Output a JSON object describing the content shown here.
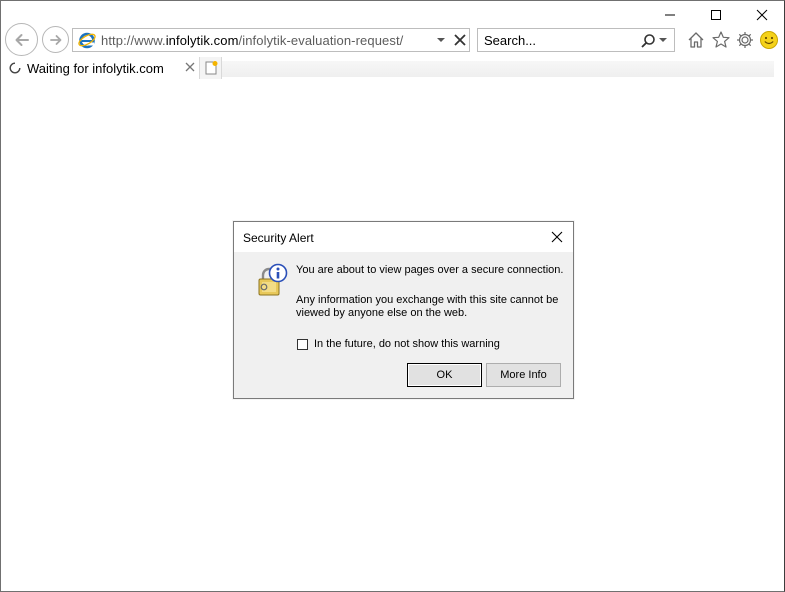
{
  "browser": {
    "address": {
      "prefix": "http://www.",
      "domain": "infolytik.com",
      "path": "/infolytik-evaluation-request/"
    },
    "search": {
      "placeholder": "Search..."
    },
    "icons": [
      "back-arrow-icon",
      "forward-arrow-icon",
      "ie-logo-icon",
      "dropdown-icon",
      "close-icon",
      "search-icon",
      "home-icon",
      "favorites-star-icon",
      "gear-icon",
      "smiley-icon"
    ]
  },
  "tabs": [
    {
      "label": "Waiting for infolytik.com",
      "loading": true
    }
  ],
  "dialog": {
    "title": "Security Alert",
    "message1": "You are about to view pages over a secure connection.",
    "message2": "Any information you exchange with this site cannot be viewed by anyone else on the web.",
    "checkbox_label": "In the future, do not show this warning",
    "checkbox_checked": false,
    "ok_label": "OK",
    "more_info_label": "More Info"
  },
  "colors": {
    "ie_blue": "#1e73be",
    "lock_gold": "#e8c85a",
    "info_blue": "#2a4fb8"
  }
}
